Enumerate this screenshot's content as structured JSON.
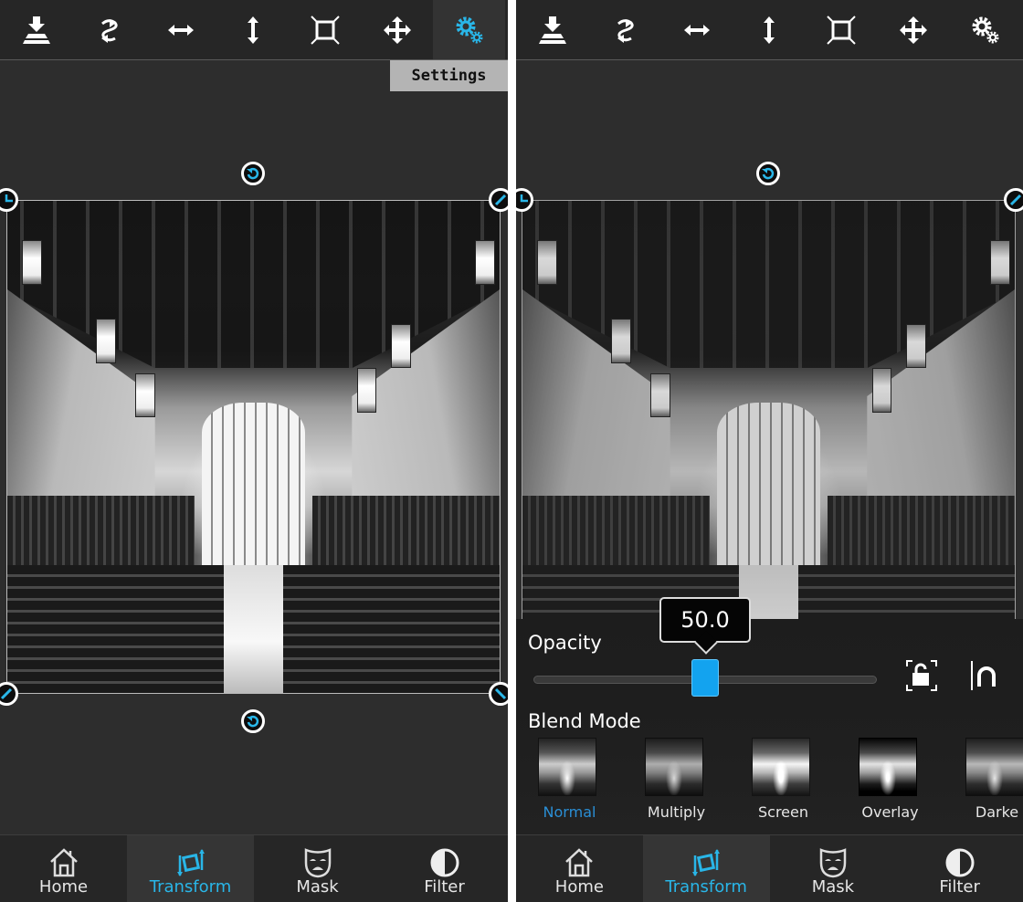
{
  "colors": {
    "accent": "#29b6e8",
    "slider": "#13a3ef",
    "background": "#2d2d2d",
    "toolbar": "#262626"
  },
  "left": {
    "toolbar": {
      "tools": [
        {
          "name": "merge-down",
          "icon": "merge-down-icon"
        },
        {
          "name": "rotate",
          "icon": "rotate-arrows-icon"
        },
        {
          "name": "flip-horizontal",
          "icon": "horizontal-arrow-icon"
        },
        {
          "name": "flip-vertical",
          "icon": "vertical-arrow-icon"
        },
        {
          "name": "crop-fit",
          "icon": "fit-frame-icon"
        },
        {
          "name": "move",
          "icon": "move-arrows-icon"
        },
        {
          "name": "settings",
          "icon": "gears-icon",
          "active": true
        }
      ],
      "tooltip": "Settings"
    }
  },
  "right": {
    "opacity": {
      "label": "Opacity",
      "value": "50.0",
      "fraction": 0.5
    },
    "blend": {
      "label": "Blend Mode",
      "modes": [
        "Normal",
        "Multiply",
        "Screen",
        "Overlay",
        "Darke"
      ],
      "selected": "Normal"
    }
  },
  "bottom_nav": {
    "items": [
      {
        "label": "Home",
        "icon": "home-icon"
      },
      {
        "label": "Transform",
        "icon": "transform-icon",
        "active": true
      },
      {
        "label": "Mask",
        "icon": "mask-icon"
      },
      {
        "label": "Filter",
        "icon": "filter-icon"
      }
    ]
  }
}
